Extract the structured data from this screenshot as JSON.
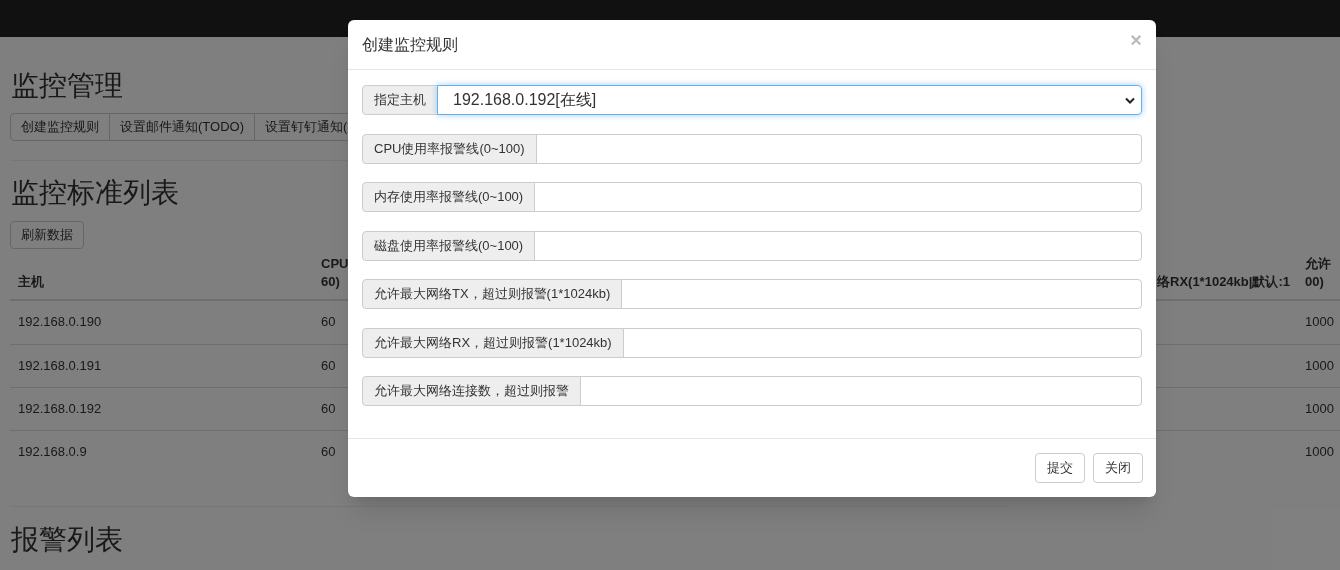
{
  "page": {
    "sections": [
      {
        "title": "监控管理",
        "buttons": [
          "创建监控规则",
          "设置邮件通知(TODO)",
          "设置钉钉通知("
        ]
      },
      {
        "title": "监控标准列表",
        "buttons": [
          "刷新数据"
        ],
        "table": {
          "columns": [
            {
              "lines": [
                "主机"
              ]
            },
            {
              "lines": [
                "CPU",
                "60)"
              ]
            },
            {
              "lines": [
                "络RX(1*1024kb|默认:1"
              ]
            },
            {
              "lines": [
                "允许",
                "00)"
              ]
            }
          ],
          "rows": [
            [
              "192.168.0.190",
              "60",
              "",
              "1000"
            ],
            [
              "192.168.0.191",
              "60",
              "",
              "1000"
            ],
            [
              "192.168.0.192",
              "60",
              "",
              "1000"
            ],
            [
              "192.168.0.9",
              "60",
              "",
              "1000"
            ]
          ]
        }
      },
      {
        "title": "报警列表"
      }
    ]
  },
  "modal": {
    "title": "创建监控规则",
    "close": "×",
    "host_select": {
      "label": "指定主机",
      "value": "192.168.0.192[在线]"
    },
    "fields": [
      {
        "label": "CPU使用率报警线(0~100)"
      },
      {
        "label": "内存使用率报警线(0~100)"
      },
      {
        "label": "磁盘使用率报警线(0~100)"
      },
      {
        "label": "允许最大网络TX，超过则报警(1*1024kb)"
      },
      {
        "label": "允许最大网络RX，超过则报警(1*1024kb)"
      },
      {
        "label": "允许最大网络连接数，超过则报警"
      }
    ],
    "buttons": [
      "提交",
      "关闭"
    ]
  }
}
